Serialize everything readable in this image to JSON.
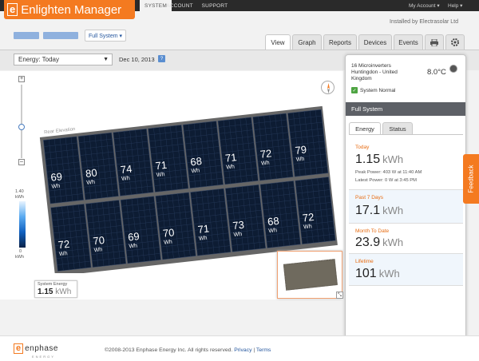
{
  "app": {
    "logo_letter": "e",
    "title": "Enlighten Manager",
    "top_tabs": [
      "SYSTEM",
      "ACCOUNT",
      "SUPPORT"
    ],
    "my_account": "My Account ▾",
    "help": "Help ▾",
    "installed_by": "Installed by Electrasolar Ltd"
  },
  "view_selector": "Full System ▾",
  "tabs": [
    "View",
    "Graph",
    "Reports",
    "Devices",
    "Events"
  ],
  "toolbar": {
    "energy_select": "Energy: Today",
    "date": "Dec 10, 2013",
    "help": "?"
  },
  "array": {
    "label": "Rear Elevation",
    "top_row": [
      "69",
      "80",
      "74",
      "71",
      "68",
      "71",
      "72",
      "79"
    ],
    "bottom_row": [
      "72",
      "70",
      "69",
      "70",
      "71",
      "73",
      "68",
      "72"
    ],
    "unit": "Wh"
  },
  "scale": {
    "max": "1.40",
    "max_unit": "kWh",
    "min": "0",
    "min_unit": "kWh"
  },
  "system_energy": {
    "label": "System Energy",
    "value": "1.15",
    "unit": "kWh"
  },
  "panel": {
    "micro_count": "16 Microinverters",
    "location_1": "Huntingdon - United",
    "location_2": "Kingdom",
    "temperature": "8.0°C",
    "status": "System Normal",
    "section": "Full System",
    "tabs": [
      "Energy",
      "Status"
    ],
    "stats": [
      {
        "label": "Today",
        "value": "1.15",
        "unit": "kWh",
        "peak": "Peak Power: 403 W at 11:40 AM",
        "latest": "Latest Power: 0 W at 3:45 PM"
      },
      {
        "label": "Past 7 Days",
        "value": "17.1",
        "unit": "kWh"
      },
      {
        "label": "Month To Date",
        "value": "23.9",
        "unit": "kWh"
      },
      {
        "label": "Lifetime",
        "value": "101",
        "unit": "kWh"
      }
    ]
  },
  "feedback": "Feedback",
  "footer": {
    "brand": "enphase",
    "brand_sub": "ENERGY",
    "copyright": "©2008-2013 Enphase Energy Inc. All rights reserved.",
    "privacy": "Privacy",
    "sep": "|",
    "terms": "Terms"
  }
}
